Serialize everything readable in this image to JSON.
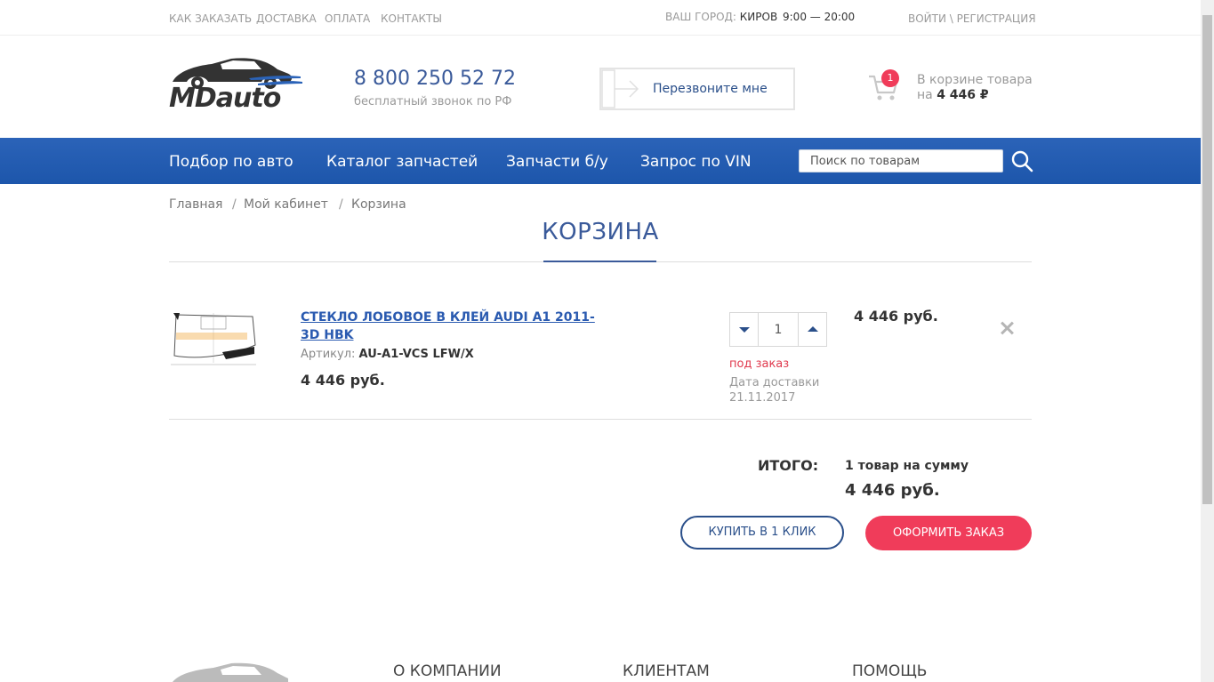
{
  "topbar": {
    "links": [
      "КАК ЗАКАЗАТЬ",
      "ДОСТАВКА",
      "ОПЛАТА",
      "КОНТАКТЫ"
    ],
    "city_label": "ВАШ ГОРОД:",
    "city_value": "КИРОВ",
    "hours": "9:00 — 20:00",
    "login": "ВОЙТИ \\ РЕГИСТРАЦИЯ"
  },
  "header": {
    "logo_text": "MDauto",
    "phone": "8 800 250 52 72",
    "phone_sub": "бесплатный звонок по РФ",
    "callback_label": "Перезвоните мне",
    "cart_badge": "1",
    "cart_text1": "В корзине товара",
    "cart_text2_prefix": "на ",
    "cart_sum": "4 446 ₽"
  },
  "nav": {
    "items": [
      "Подбор по авто",
      "Каталог запчастей",
      "Запчасти б/у",
      "Запрос по VIN"
    ],
    "search_placeholder": "Поиск по товарам"
  },
  "breadcrumb": [
    "Главная",
    "Мой кабинет",
    "Корзина"
  ],
  "breadcrumb_sep": "/",
  "page_title": "КОРЗИНА",
  "cart_item": {
    "name": "СТЕКЛО ЛОБОВОЕ В КЛЕЙ AUDI A1 2011- 3D HBK",
    "sku_label": "Артикул: ",
    "sku": "AU-A1-VCS LFW/X",
    "price": "4 446 руб.",
    "quantity": "1",
    "stock_status": "под заказ",
    "delivery_label": "Дата доставки",
    "delivery_date": "21.11.2017",
    "row_price": "4 446 руб."
  },
  "totals": {
    "label": "ИТОГО:",
    "count": "1 товар на сумму",
    "sum": "4 446 руб.",
    "oneclick_label": "КУПИТЬ В 1 КЛИК",
    "order_label": "ОФОРМИТЬ ЗАКАЗ"
  },
  "footer": {
    "columns": [
      "О КОМПАНИИ",
      "КЛИЕНТАМ",
      "ПОМОЩЬ"
    ]
  },
  "colors": {
    "brand_blue": "#1d56ab",
    "accent_red": "#f03c5a",
    "link_blue": "#2a5ab0"
  }
}
